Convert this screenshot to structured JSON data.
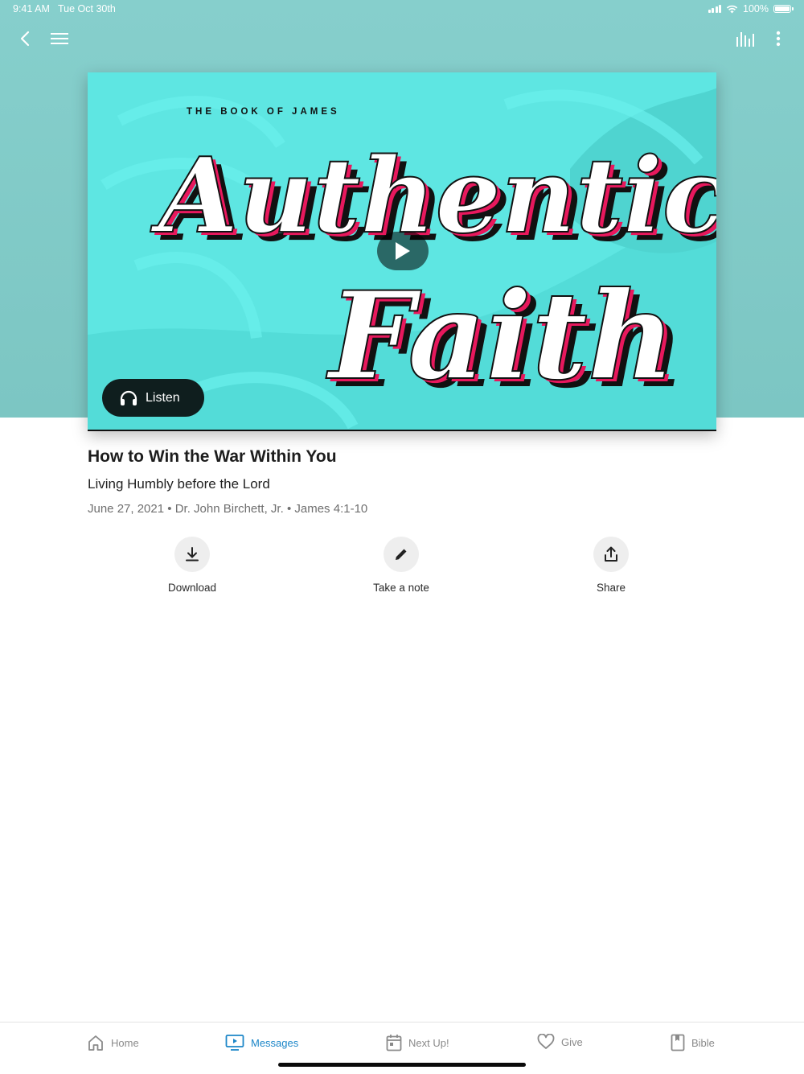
{
  "status_bar": {
    "time": "9:41 AM",
    "date": "Tue Oct 30th",
    "battery": "100%"
  },
  "nav": {
    "back_icon": "chevron-left-icon",
    "menu_icon": "hamburger-menu-icon",
    "now_playing_icon": "audio-bars-icon",
    "more_icon": "vertical-dots-icon"
  },
  "artwork": {
    "series_kicker": "THE BOOK OF JAMES",
    "line1": "Authentic",
    "line2": "Faith",
    "listen_label": "Listen",
    "colors": {
      "background": "#5ee6e2",
      "accent": "#e8185d",
      "shadow": "#111111"
    }
  },
  "message": {
    "title": "How to Win the War Within You",
    "subtitle": "Living Humbly before the Lord",
    "date": "June 27, 2021",
    "speaker": "Dr. John Birchett, Jr.",
    "scripture": "James 4:1-10",
    "separator": "•"
  },
  "actions": [
    {
      "label": "Download",
      "icon": "download-icon"
    },
    {
      "label": "Take a note",
      "icon": "pencil-icon"
    },
    {
      "label": "Share",
      "icon": "share-icon"
    }
  ],
  "tabs": [
    {
      "label": "Home",
      "icon": "home-icon",
      "active": false
    },
    {
      "label": "Messages",
      "icon": "tv-play-icon",
      "active": true
    },
    {
      "label": "Next Up!",
      "icon": "calendar-icon",
      "active": false
    },
    {
      "label": "Give",
      "icon": "heart-icon",
      "active": false
    },
    {
      "label": "Bible",
      "icon": "book-icon",
      "active": false
    }
  ],
  "theme": {
    "header_bg": "#7fc8c5",
    "active_tab": "#1c86c8"
  }
}
